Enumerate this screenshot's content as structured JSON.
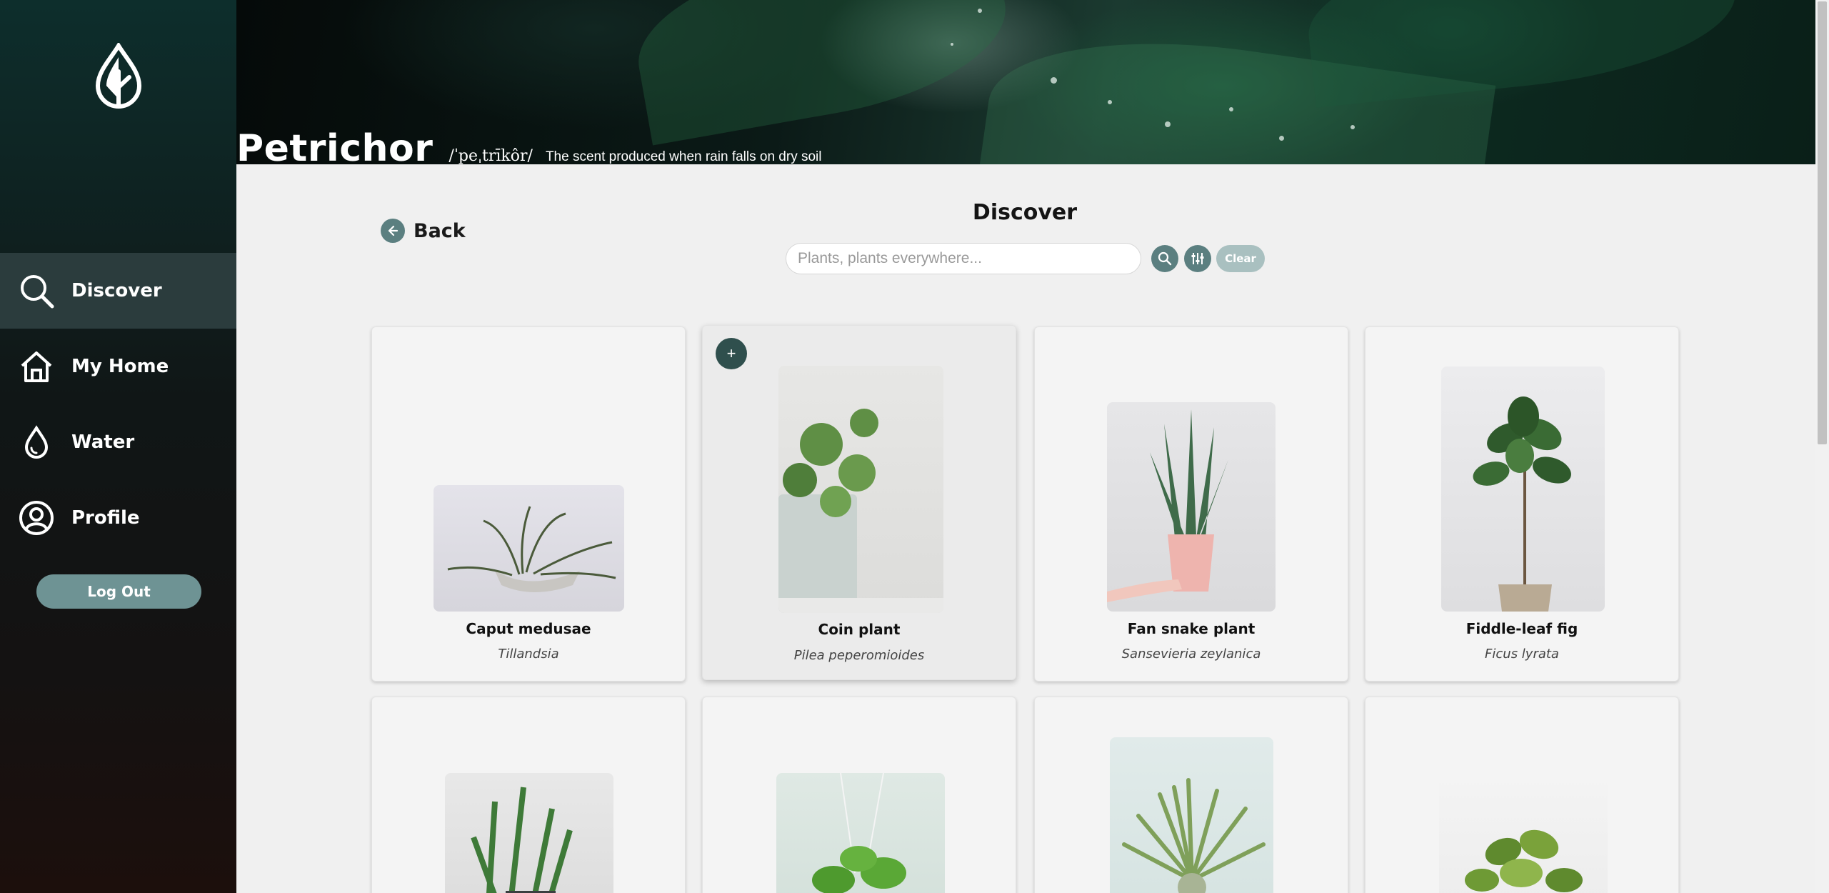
{
  "app": {
    "brand_title": "Petrichor",
    "brand_phonetic": "/ˈpeˌtrīkôr/",
    "brand_definition": "The scent produced when rain falls on dry soil"
  },
  "sidebar": {
    "logo_icon": "leaf-drop-icon",
    "items": [
      {
        "label": "Discover",
        "icon": "search-icon",
        "active": true
      },
      {
        "label": "My Home",
        "icon": "home-icon",
        "active": false
      },
      {
        "label": "Water",
        "icon": "water-drop-icon",
        "active": false
      },
      {
        "label": "Profile",
        "icon": "user-icon",
        "active": false
      }
    ],
    "logout_label": "Log Out"
  },
  "header": {
    "back_label": "Back",
    "title": "Discover",
    "search_placeholder": "Plants, plants everywhere...",
    "search_value": "",
    "clear_label": "Clear"
  },
  "plants": [
    {
      "name": "Caput medusae",
      "scientific": "Tillandsia"
    },
    {
      "name": "Coin plant",
      "scientific": "Pilea peperomioides",
      "add_label": "+"
    },
    {
      "name": "Fan snake plant",
      "scientific": "Sansevieria zeylanica"
    },
    {
      "name": "Fiddle-leaf fig",
      "scientific": "Ficus lyrata"
    }
  ],
  "colors": {
    "accent": "#5b7f80",
    "sidebar_active": "#2b3c3d",
    "add_button": "#2f4f4d",
    "clear_button": "#a9c0c0"
  }
}
